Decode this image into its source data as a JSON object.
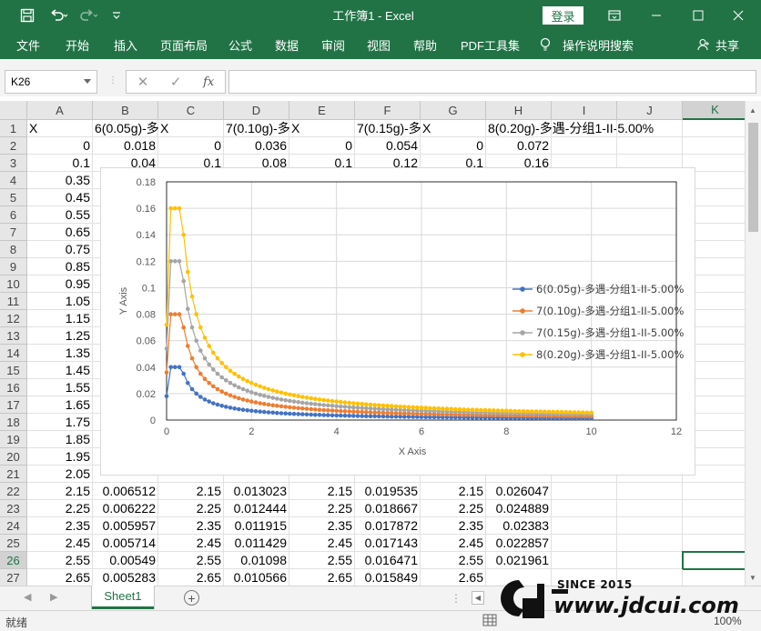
{
  "titlebar": {
    "title": "工作簿1  -  Excel",
    "login_label": "登录",
    "save_icon": "save-icon",
    "undo_icon": "undo-icon",
    "redo_icon": "redo-icon"
  },
  "menu": {
    "items": [
      "文件",
      "开始",
      "插入",
      "页面布局",
      "公式",
      "数据",
      "审阅",
      "视图",
      "帮助",
      "PDF工具集",
      "操作说明搜索"
    ],
    "share_label": "共享"
  },
  "formula_bar": {
    "name_box": "K26",
    "fx_label": "fx",
    "value": ""
  },
  "columns": [
    "A",
    "B",
    "C",
    "D",
    "E",
    "F",
    "G",
    "H",
    "I",
    "J",
    "K"
  ],
  "rows": [
    {
      "n": "1",
      "cells": [
        "X",
        "6(0.05g)-多",
        "X",
        "7(0.10g)-多",
        "X",
        "7(0.15g)-多",
        "X",
        "8(0.20g)-多遇-分组1-II-5.00%",
        "",
        "",
        ""
      ]
    },
    {
      "n": "2",
      "cells": [
        "0",
        "0.018",
        "0",
        "0.036",
        "0",
        "0.054",
        "0",
        "0.072",
        "",
        "",
        ""
      ]
    },
    {
      "n": "3",
      "cells": [
        "0.1",
        "0.04",
        "0.1",
        "0.08",
        "0.1",
        "0.12",
        "0.1",
        "0.16",
        "",
        "",
        ""
      ]
    },
    {
      "n": "4",
      "cells": [
        "0.35",
        "",
        "",
        "",
        "",
        "",
        "",
        "",
        "",
        "",
        ""
      ]
    },
    {
      "n": "5",
      "cells": [
        "0.45",
        "",
        "",
        "",
        "",
        "",
        "",
        "",
        "",
        "",
        ""
      ]
    },
    {
      "n": "6",
      "cells": [
        "0.55",
        "",
        "",
        "",
        "",
        "",
        "",
        "",
        "",
        "",
        ""
      ]
    },
    {
      "n": "7",
      "cells": [
        "0.65",
        "",
        "",
        "",
        "",
        "",
        "",
        "",
        "",
        "",
        ""
      ]
    },
    {
      "n": "8",
      "cells": [
        "0.75",
        "",
        "",
        "",
        "",
        "",
        "",
        "",
        "",
        "",
        ""
      ]
    },
    {
      "n": "9",
      "cells": [
        "0.85",
        "",
        "",
        "",
        "",
        "",
        "",
        "",
        "",
        "",
        ""
      ]
    },
    {
      "n": "10",
      "cells": [
        "0.95",
        "",
        "",
        "",
        "",
        "",
        "",
        "",
        "",
        "",
        ""
      ]
    },
    {
      "n": "11",
      "cells": [
        "1.05",
        "",
        "",
        "",
        "",
        "",
        "",
        "",
        "",
        "",
        ""
      ]
    },
    {
      "n": "12",
      "cells": [
        "1.15",
        "",
        "",
        "",
        "",
        "",
        "",
        "",
        "",
        "",
        ""
      ]
    },
    {
      "n": "13",
      "cells": [
        "1.25",
        "",
        "",
        "",
        "",
        "",
        "",
        "",
        "",
        "",
        ""
      ]
    },
    {
      "n": "14",
      "cells": [
        "1.35",
        "",
        "",
        "",
        "",
        "",
        "",
        "",
        "",
        "",
        ""
      ]
    },
    {
      "n": "15",
      "cells": [
        "1.45",
        "",
        "",
        "",
        "",
        "",
        "",
        "",
        "",
        "",
        ""
      ]
    },
    {
      "n": "16",
      "cells": [
        "1.55",
        "",
        "",
        "",
        "",
        "",
        "",
        "",
        "",
        "",
        ""
      ]
    },
    {
      "n": "17",
      "cells": [
        "1.65",
        "",
        "",
        "",
        "",
        "",
        "",
        "",
        "",
        "",
        ""
      ]
    },
    {
      "n": "18",
      "cells": [
        "1.75",
        "",
        "",
        "",
        "",
        "",
        "",
        "",
        "",
        "",
        ""
      ]
    },
    {
      "n": "19",
      "cells": [
        "1.85",
        "",
        "",
        "",
        "",
        "",
        "",
        "",
        "",
        "",
        ""
      ]
    },
    {
      "n": "20",
      "cells": [
        "1.95",
        "",
        "",
        "",
        "",
        "",
        "",
        "",
        "",
        "",
        ""
      ]
    },
    {
      "n": "21",
      "cells": [
        "2.05",
        "",
        "",
        "",
        "",
        "",
        "",
        "",
        "",
        "",
        ""
      ]
    },
    {
      "n": "22",
      "cells": [
        "2.15",
        "0.006512",
        "2.15",
        "0.013023",
        "2.15",
        "0.019535",
        "2.15",
        "0.026047",
        "",
        "",
        ""
      ]
    },
    {
      "n": "23",
      "cells": [
        "2.25",
        "0.006222",
        "2.25",
        "0.012444",
        "2.25",
        "0.018667",
        "2.25",
        "0.024889",
        "",
        "",
        ""
      ]
    },
    {
      "n": "24",
      "cells": [
        "2.35",
        "0.005957",
        "2.35",
        "0.011915",
        "2.35",
        "0.017872",
        "2.35",
        "0.02383",
        "",
        "",
        ""
      ]
    },
    {
      "n": "25",
      "cells": [
        "2.45",
        "0.005714",
        "2.45",
        "0.011429",
        "2.45",
        "0.017143",
        "2.45",
        "0.022857",
        "",
        "",
        ""
      ]
    },
    {
      "n": "26",
      "cells": [
        "2.55",
        "0.00549",
        "2.55",
        "0.01098",
        "2.55",
        "0.016471",
        "2.55",
        "0.021961",
        "",
        "",
        ""
      ]
    },
    {
      "n": "27",
      "cells": [
        "2.65",
        "0.005283",
        "2.65",
        "0.010566",
        "2.65",
        "0.015849",
        "2.65",
        "",
        "",
        "",
        ""
      ]
    }
  ],
  "selected_row": "26",
  "selected_col": "K",
  "chart": {
    "xlabel": "X Axis",
    "ylabel": "Y Axis",
    "xticks": [
      "0",
      "2",
      "4",
      "6",
      "8",
      "10",
      "12"
    ],
    "yticks": [
      "0",
      "0.02",
      "0.04",
      "0.06",
      "0.08",
      "0.1",
      "0.12",
      "0.14",
      "0.16",
      "0.18"
    ],
    "series": [
      {
        "name": "6(0.05g)-多遇-分组1-II-5.00%",
        "color": "#4472c4",
        "amax": 0.04
      },
      {
        "name": "7(0.10g)-多遇-分组1-II-5.00%",
        "color": "#ed7d31",
        "amax": 0.08
      },
      {
        "name": "7(0.15g)-多遇-分组1-II-5.00%",
        "color": "#a5a5a5",
        "amax": 0.12
      },
      {
        "name": "8(0.20g)-多遇-分组1-II-5.00%",
        "color": "#ffc000",
        "amax": 0.16
      }
    ]
  },
  "chart_data": {
    "type": "scatter",
    "xlabel": "X Axis",
    "ylabel": "Y Axis",
    "xlim": [
      0,
      12
    ],
    "ylim": [
      0,
      0.18
    ],
    "grid": true,
    "legend": "right",
    "series": [
      {
        "name": "6(0.05g)-多遇-分组1-II-5.00%",
        "x0": 0,
        "y0": 0.018,
        "peak": 0.04,
        "plateau_end": 0.35,
        "end_x": 10
      },
      {
        "name": "7(0.10g)-多遇-分组1-II-5.00%",
        "x0": 0,
        "y0": 0.036,
        "peak": 0.08,
        "plateau_end": 0.35,
        "end_x": 10
      },
      {
        "name": "7(0.15g)-多遇-分组1-II-5.00%",
        "x0": 0,
        "y0": 0.054,
        "peak": 0.12,
        "plateau_end": 0.35,
        "end_x": 10
      },
      {
        "name": "8(0.20g)-多遇-分组1-II-5.00%",
        "x0": 0,
        "y0": 0.072,
        "peak": 0.16,
        "plateau_end": 0.35,
        "end_x": 10
      }
    ]
  },
  "sheet_tab": "Sheet1",
  "status": {
    "ready": "就绪",
    "zoom": "100%"
  },
  "watermark": {
    "since": "SINCE 2015",
    "site": "www.jdcui.com"
  }
}
